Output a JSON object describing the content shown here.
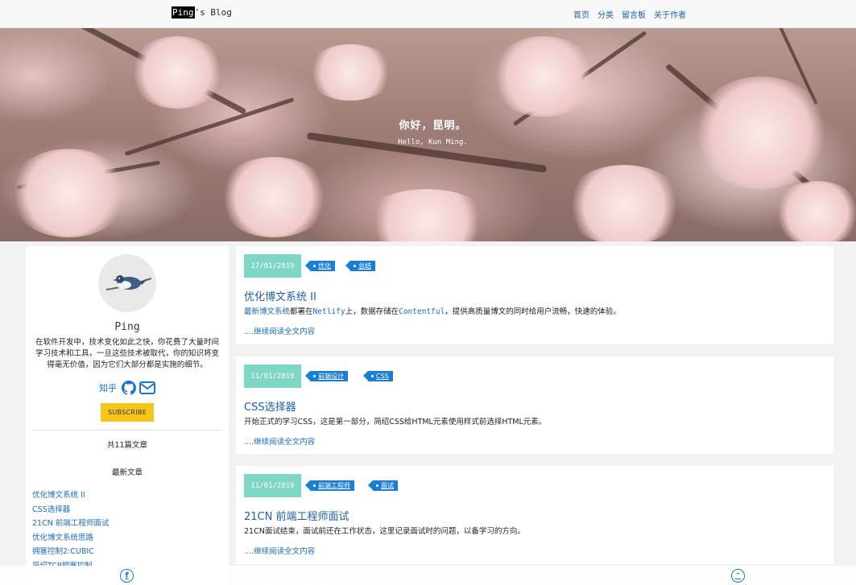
{
  "header": {
    "brand_highlight": "Ping",
    "brand_rest": "'s Blog",
    "nav": [
      "首页",
      "分类",
      "留言板",
      "关于作者"
    ]
  },
  "hero": {
    "title": "你好，昆明。",
    "subtitle": "Hello, Kun Ming."
  },
  "sidebar": {
    "author": "Ping",
    "bio": "在软件开发中，技术变化如此之快，你花费了大量时间学习技术和工具，一旦这些技术被取代，你的知识将变得毫无价值，因为它们大部分都是实施的细节。",
    "zhihu": "知乎",
    "subscribe_label": "SUBSCRIBE",
    "total": "共11篇文章",
    "recent_title": "最新文章",
    "recent": [
      "优化博文系统 II",
      "CSS选择器",
      "21CN 前端工程师面试",
      "优化博文系统思路",
      "拥塞控制2:CUBIC",
      "简绍TCP拥塞控制"
    ]
  },
  "posts": [
    {
      "date": "17/01/2019",
      "tags": [
        "优化",
        "总结"
      ],
      "title": "优化博文系统 II",
      "excerpt": {
        "p1": "最新博文系统",
        "p2": "都署在",
        "p3": "Netlify",
        "p4": "上，数据存储在",
        "p5": "Contentful",
        "p6": "，提供高质量博文的同时给用户流畅，快速的体验。"
      },
      "more": "....继续阅读全文内容"
    },
    {
      "date": "11/01/2019",
      "tags": [
        "前端设计",
        "CSS"
      ],
      "title": "CSS选择器",
      "excerpt_text": "开始正式的学习CSS，这是第一部分，简绍CSS给HTML元素使用样式前选择HTML元素。",
      "more": "....继续阅读全文内容"
    },
    {
      "date": "11/01/2019",
      "tags": [
        "前端工程师",
        "面试"
      ],
      "title": "21CN 前端工程师面试",
      "excerpt_text": "21CN面试结束，面试前还在工作状态，这里记录面试时的问题，以备学习的方向。",
      "more": "....继续阅读全文内容"
    }
  ],
  "footer": {
    "facebook_letter": "f",
    "top_arrow": "⌃"
  },
  "colors": {
    "accent_blue": "#1a7fd4",
    "date_teal": "#7fd6c4",
    "subscribe_yellow": "#f5c518"
  }
}
